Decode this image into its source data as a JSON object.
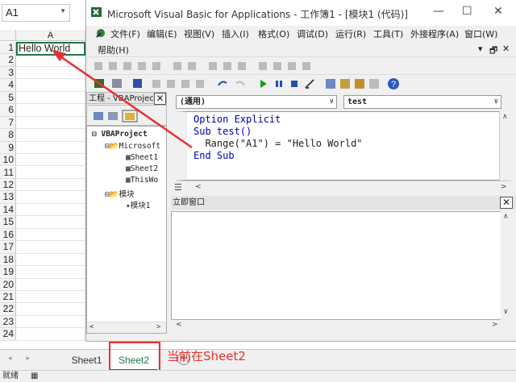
{
  "excel": {
    "name_box": "A1",
    "column_header": "A",
    "cell_a1": "Hello World",
    "row_numbers": [
      "1",
      "2",
      "3",
      "4",
      "5",
      "6",
      "7",
      "8",
      "9",
      "10",
      "11",
      "12",
      "13",
      "14",
      "15",
      "16",
      "17",
      "18",
      "19",
      "20",
      "21",
      "22",
      "23",
      "24"
    ],
    "sheet_tabs": [
      "Sheet1",
      "Sheet2"
    ],
    "active_sheet": "Sheet2",
    "status": "就绪"
  },
  "annotation": "当前在Sheet2",
  "vbe": {
    "title": "Microsoft Visual Basic for Applications - 工作簿1 - [模块1 (代码)]",
    "menus": [
      "文件(F)",
      "编辑(E)",
      "视图(V)",
      "插入(I)",
      "格式(O)",
      "调试(D)",
      "运行(R)",
      "工具(T)",
      "外接程序(A)",
      "窗口(W)"
    ],
    "help_menu": "帮助(H)",
    "project_pane_title": "工程 - VBAProject",
    "tree": [
      "VBAProject",
      "Microsoft",
      "Sheet1",
      "Sheet2",
      "ThisWo",
      "模块",
      "模块1"
    ],
    "object_combo": "(通用)",
    "proc_combo": "test",
    "code_lines": [
      "Option Explicit",
      "Sub test()",
      "  Range(\"A1\") = \"Hello World\"",
      "End Sub"
    ],
    "immediate_title": "立即窗口"
  },
  "colors": {
    "excel_green": "#217346",
    "annotation_red": "#e53232",
    "keyword_blue": "#0000b0"
  },
  "icons": [
    "excel-vba-icon",
    "minimize-icon",
    "maximize-icon",
    "close-icon",
    "run-icon",
    "pause-icon",
    "stop-icon",
    "help-icon",
    "folder-icon",
    "module-icon",
    "sheet-icon"
  ]
}
